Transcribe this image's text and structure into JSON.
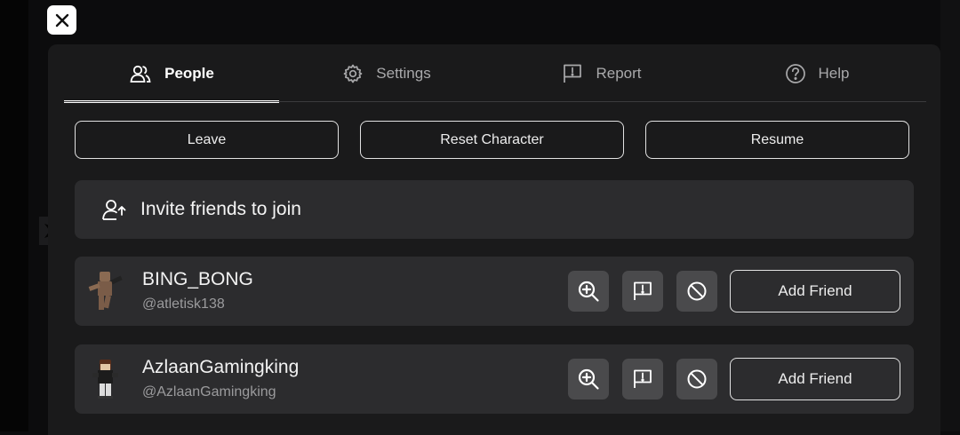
{
  "close_icon": "close-icon",
  "tabs": [
    {
      "label": "People",
      "icon": "people-icon",
      "active": true
    },
    {
      "label": "Settings",
      "icon": "gear-icon",
      "active": false
    },
    {
      "label": "Report",
      "icon": "flag-icon",
      "active": false
    },
    {
      "label": "Help",
      "icon": "help-icon",
      "active": false
    }
  ],
  "actions": {
    "leave": "Leave",
    "reset": "Reset Character",
    "resume": "Resume"
  },
  "invite": {
    "label": "Invite friends to join",
    "icon": "invite-friend-icon"
  },
  "players": [
    {
      "display_name": "BING_BONG",
      "username": "@atletisk138",
      "add_friend": "Add Friend"
    },
    {
      "display_name": "AzlaanGamingking",
      "username": "@AzlaanGamingking",
      "add_friend": "Add Friend"
    }
  ],
  "colors": {
    "background": "#0c0c0d",
    "panel": "#1a1a1b",
    "card": "#2c2c2e",
    "icon_button": "#4a4a4c",
    "text": "#f2f2f2",
    "muted_text": "#9b9b9d"
  }
}
